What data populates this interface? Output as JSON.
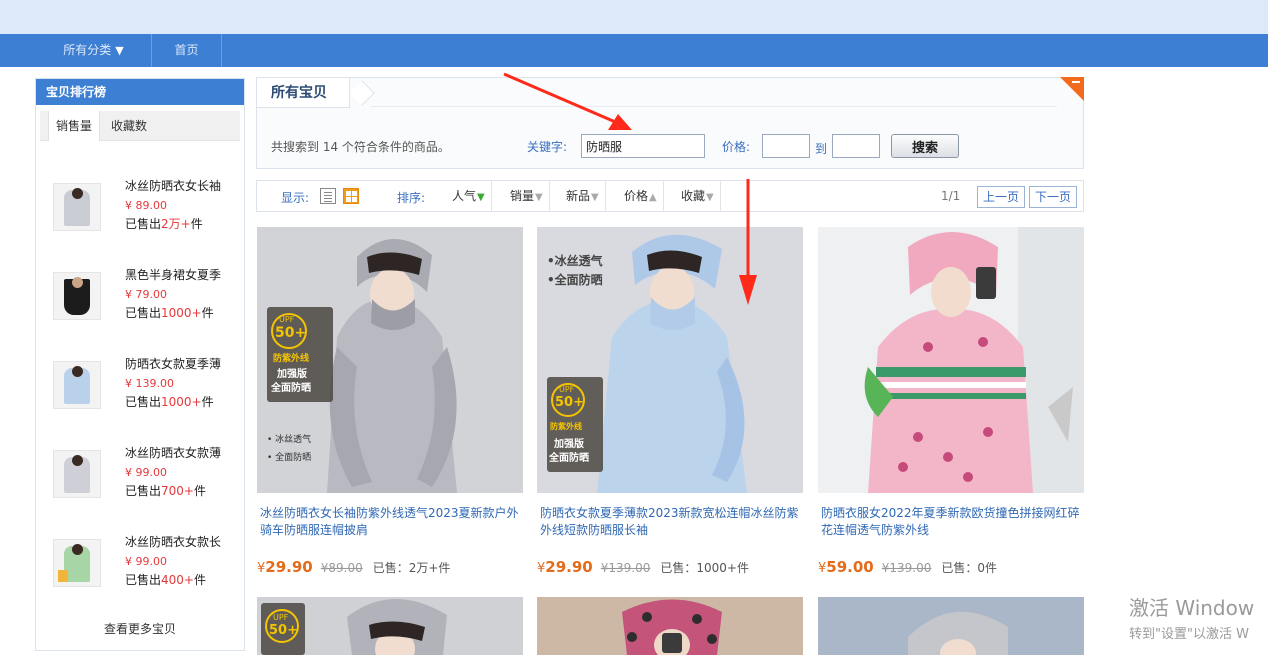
{
  "nav": {
    "category_label": "所有分类",
    "home_label": "首页"
  },
  "sidebar": {
    "title": "宝贝排行榜",
    "tabs": [
      "销售量",
      "收藏数"
    ],
    "items": [
      {
        "name": "冰丝防晒衣女长袖",
        "price": "¥ 89.00",
        "sold_prefix": "已售出",
        "sold_num": "2万+",
        "sold_suffix": "件"
      },
      {
        "name": "黑色半身裙女夏季",
        "price": "¥ 79.00",
        "sold_prefix": "已售出",
        "sold_num": "1000+",
        "sold_suffix": "件"
      },
      {
        "name": "防晒衣女款夏季薄",
        "price": "¥ 139.00",
        "sold_prefix": "已售出",
        "sold_num": "1000+",
        "sold_suffix": "件"
      },
      {
        "name": "冰丝防晒衣女款薄",
        "price": "¥ 99.00",
        "sold_prefix": "已售出",
        "sold_num": "700+",
        "sold_suffix": "件"
      },
      {
        "name": "冰丝防晒衣女款长",
        "price": "¥ 99.00",
        "sold_prefix": "已售出",
        "sold_num": "400+",
        "sold_suffix": "件"
      }
    ],
    "more_label": "查看更多宝贝"
  },
  "search": {
    "title": "所有宝贝",
    "result_text": "共搜索到 14 个符合条件的商品。",
    "keyword_label": "关键字:",
    "keyword_value": "防晒服",
    "price_label": "价格:",
    "to_label": "到",
    "button_label": "搜索"
  },
  "toolbar": {
    "display_label": "显示:",
    "sort_label": "排序:",
    "sort_items": [
      "人气",
      "销量",
      "新品",
      "价格",
      "收藏"
    ],
    "page_info": "1/1",
    "prev_label": "上一页",
    "next_label": "下一页"
  },
  "products": [
    {
      "title": "冰丝防晒衣女长袖防紫外线透气2023夏新款户外骑车防晒服连帽披肩",
      "currency": "¥",
      "price": "29.90",
      "old_price": "¥89.00",
      "sold": "已售：2万+件",
      "badge_top": "UPF",
      "badge_num": "50+",
      "badge_sub": "防紫外线",
      "badge_line1": "加强版",
      "badge_line2": "全面防晒",
      "bullet1": "• 冰丝透气",
      "bullet2": "• 全面防晒"
    },
    {
      "title": "防晒衣女款夏季薄款2023新款宽松连帽冰丝防紫外线短款防晒服长袖",
      "currency": "¥",
      "price": "29.90",
      "old_price": "¥139.00",
      "sold": "已售：1000+件",
      "tag1": "•冰丝透气",
      "tag2": "•全面防晒",
      "badge_top": "UPF",
      "badge_num": "50+",
      "badge_sub": "防紫外线",
      "badge_line1": "加强版",
      "badge_line2": "全面防晒"
    },
    {
      "title": "防晒衣服女2022年夏季新款欧货撞色拼接网红碎花连帽透气防紫外线",
      "currency": "¥",
      "price": "59.00",
      "old_price": "¥139.00",
      "sold": "已售：0件"
    }
  ],
  "row2": {
    "badge_top": "UPF",
    "badge_num": "50+"
  },
  "watermark": {
    "line1": "激活 Window",
    "line2": "转到\"设置\"以激活 W"
  },
  "colors": {
    "nav_blue": "#3d7fd3",
    "price_orange": "#e46b1a",
    "link_blue": "#2f68b4",
    "annotation_red": "#ff2a1a"
  }
}
